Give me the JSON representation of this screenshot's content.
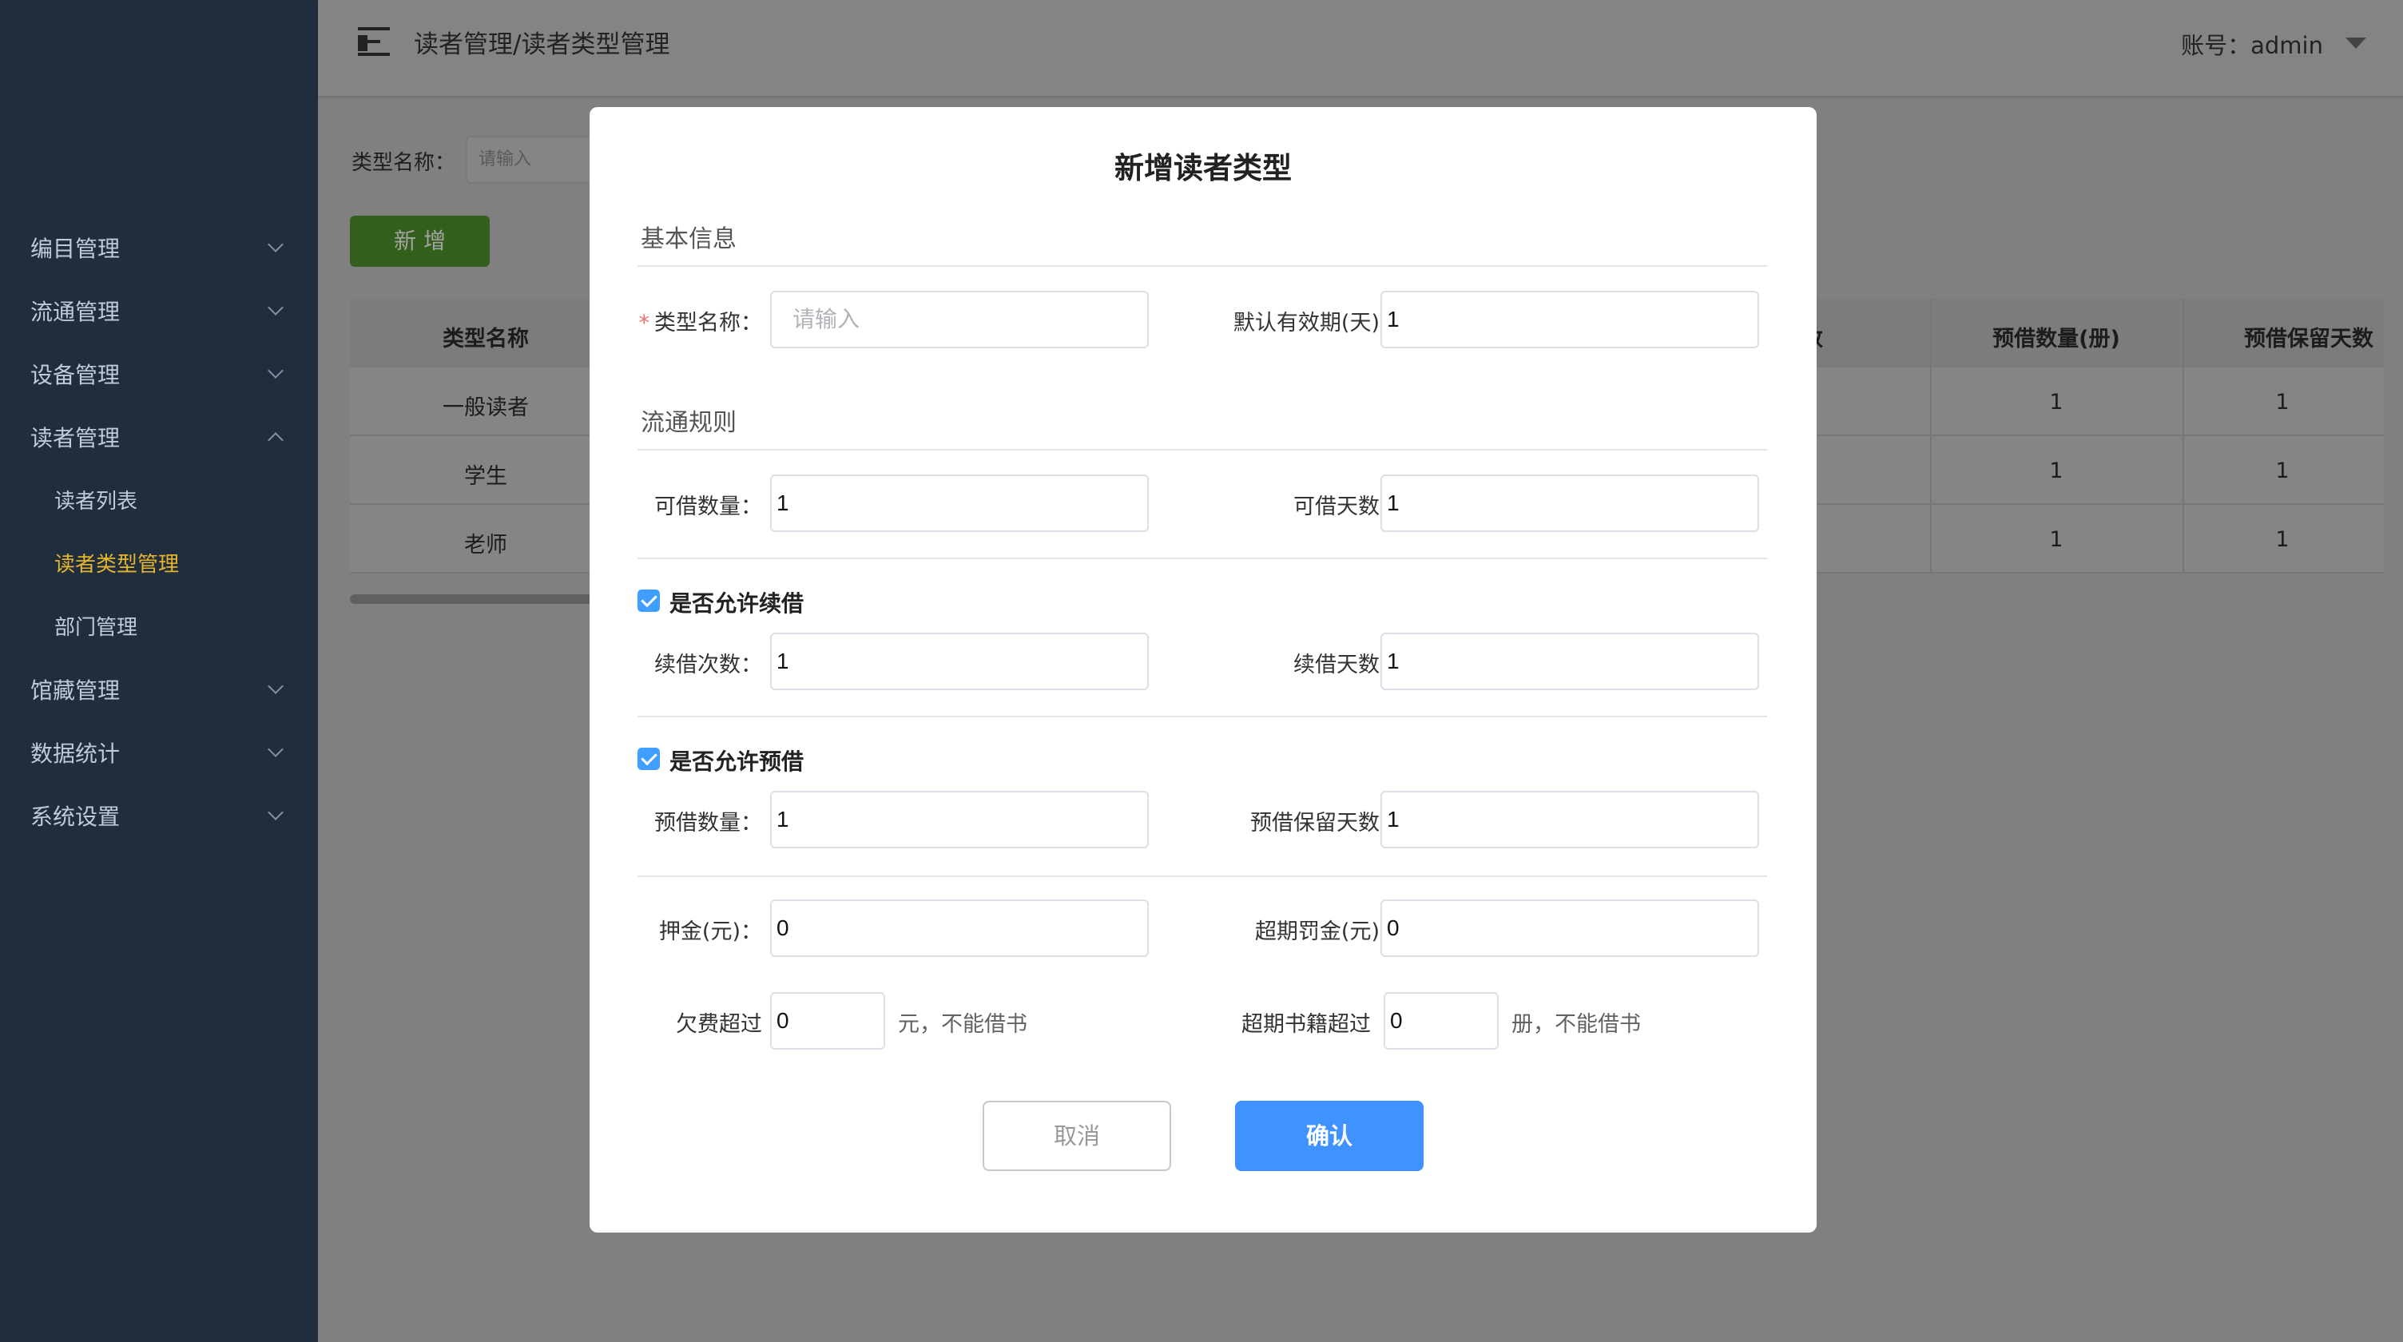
{
  "sidebar": {
    "menu": [
      {
        "label": "编目管理"
      },
      {
        "label": "流通管理"
      },
      {
        "label": "设备管理"
      },
      {
        "label": "读者管理"
      },
      {
        "label": "馆藏管理"
      },
      {
        "label": "数据统计"
      },
      {
        "label": "系统设置"
      }
    ],
    "sub": [
      {
        "label": "读者列表"
      },
      {
        "label": "读者类型管理"
      },
      {
        "label": "部门管理"
      }
    ]
  },
  "header": {
    "breadcrumb": "读者管理/读者类型管理",
    "account": "账号：admin"
  },
  "filter": {
    "label": "类型名称：",
    "placeholder": "请输入"
  },
  "add_button": "新 增",
  "table": {
    "columns": [
      "类型名称",
      "天数",
      "预借数量(册)",
      "预借保留天数"
    ],
    "rows": [
      {
        "name": "一般读者",
        "reserve_count": "1",
        "reserve_days": "1"
      },
      {
        "name": "学生",
        "reserve_count": "1",
        "reserve_days": "1"
      },
      {
        "name": "老师",
        "reserve_count": "1",
        "reserve_days": "1"
      }
    ]
  },
  "modal": {
    "title": "新增读者类型",
    "section_basic": "基本信息",
    "section_rules": "流通规则",
    "type_name_label": "类型名称：",
    "type_name_placeholder": "请输入",
    "validity_label": "默认有效期(天)：",
    "validity_value": "1",
    "borrow_count_label": "可借数量：",
    "borrow_count_value": "1",
    "borrow_days_label": "可借天数：",
    "borrow_days_value": "1",
    "allow_renew_label": "是否允许续借",
    "renew_times_label": "续借次数：",
    "renew_times_value": "1",
    "renew_days_label": "续借天数：",
    "renew_days_value": "1",
    "allow_reserve_label": "是否允许预借",
    "reserve_count_label": "预借数量：",
    "reserve_count_value": "1",
    "reserve_days_label": "预借保留天数：",
    "reserve_days_value": "1",
    "deposit_label": "押金(元)：",
    "deposit_value": "0",
    "overdue_fine_label": "超期罚金(元)：",
    "overdue_fine_value": "0",
    "debt_label": "欠费超过",
    "debt_value": "0",
    "debt_suffix": "元，不能借书",
    "overdue_books_label": "超期书籍超过",
    "overdue_books_value": "0",
    "overdue_books_suffix": "册，不能借书",
    "cancel_label": "取消",
    "confirm_label": "确认"
  }
}
